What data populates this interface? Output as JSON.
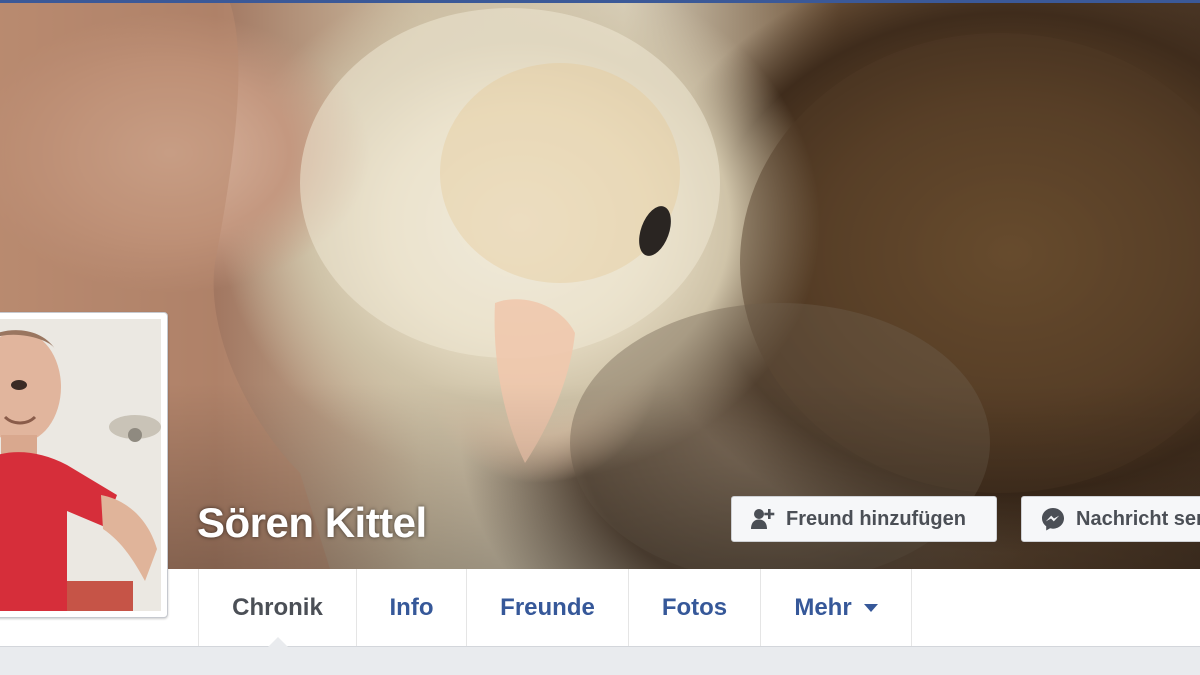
{
  "profile": {
    "name": "Sören Kittel"
  },
  "cover_actions": {
    "add_friend_label": "Freund hinzufügen",
    "add_friend_icon": "add-friend-icon",
    "message_label": "Nachricht senden",
    "message_icon": "messenger-icon"
  },
  "tabs": [
    {
      "label": "Chronik",
      "active": true
    },
    {
      "label": "Info",
      "active": false
    },
    {
      "label": "Freunde",
      "active": false
    },
    {
      "label": "Fotos",
      "active": false
    },
    {
      "label": "Mehr",
      "active": false,
      "has_dropdown": true
    }
  ],
  "colors": {
    "link_blue": "#365899",
    "topbar_blue": "#3b5998",
    "page_bg": "#e9ebee",
    "active_tab_text": "#4b4f56"
  }
}
